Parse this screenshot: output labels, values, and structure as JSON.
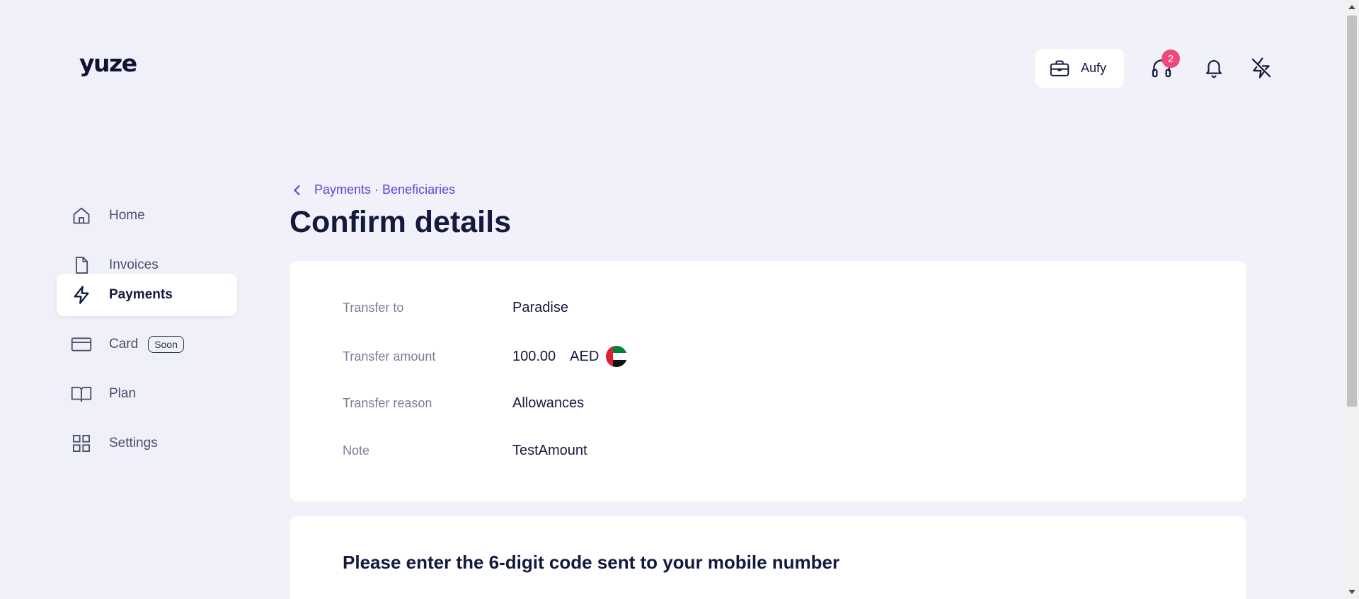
{
  "brand": {
    "logo_text": "yuze"
  },
  "sidebar": {
    "items": [
      {
        "label": "Home",
        "icon": "home-icon",
        "active": false
      },
      {
        "label": "Invoices",
        "icon": "document-icon",
        "active": false
      },
      {
        "label": "Payments",
        "icon": "lightning-icon",
        "active": true
      },
      {
        "label": "Card",
        "icon": "card-icon",
        "active": false,
        "badge": "Soon"
      },
      {
        "label": "Plan",
        "icon": "book-icon",
        "active": false
      },
      {
        "label": "Settings",
        "icon": "grid-icon",
        "active": false
      }
    ]
  },
  "header": {
    "org_label": "Aufy",
    "support_badge_count": "2"
  },
  "breadcrumb": {
    "text": "Payments · Beneficiaries"
  },
  "page": {
    "title": "Confirm details"
  },
  "details": {
    "transfer_to_label": "Transfer to",
    "transfer_to_value": "Paradise",
    "amount_label": "Transfer amount",
    "amount_value": "100.00",
    "amount_currency": "AED",
    "reason_label": "Transfer reason",
    "reason_value": "Allowances",
    "note_label": "Note",
    "note_value": "TestAmount"
  },
  "otp": {
    "title": "Please enter the 6-digit code sent to your mobile number"
  },
  "colors": {
    "accent": "#5b45d9",
    "text_primary": "#141a3d",
    "badge": "#f0467b",
    "background": "#f0f1f9"
  }
}
